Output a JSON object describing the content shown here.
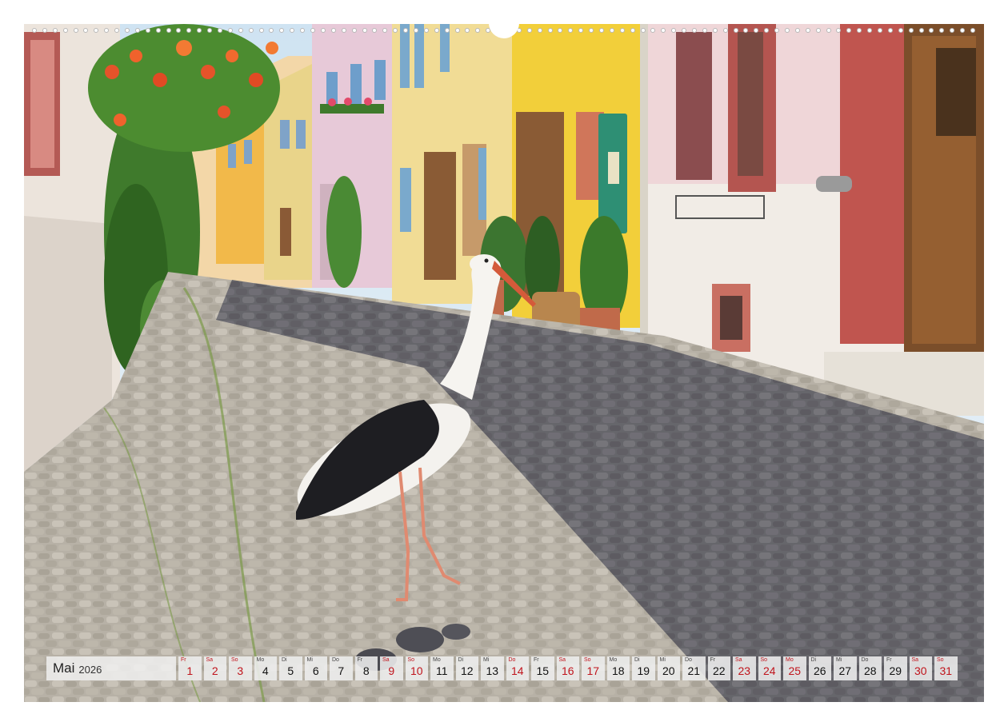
{
  "calendar": {
    "month": "Mai",
    "year": "2026",
    "accent_color": "#c0141c",
    "days": [
      {
        "dow": "Fr",
        "num": "1",
        "red": true
      },
      {
        "dow": "Sa",
        "num": "2",
        "red": true
      },
      {
        "dow": "So",
        "num": "3",
        "red": true
      },
      {
        "dow": "Mo",
        "num": "4",
        "red": false
      },
      {
        "dow": "Di",
        "num": "5",
        "red": false
      },
      {
        "dow": "Mi",
        "num": "6",
        "red": false
      },
      {
        "dow": "Do",
        "num": "7",
        "red": false
      },
      {
        "dow": "Fr",
        "num": "8",
        "red": false
      },
      {
        "dow": "Sa",
        "num": "9",
        "red": true
      },
      {
        "dow": "So",
        "num": "10",
        "red": true
      },
      {
        "dow": "Mo",
        "num": "11",
        "red": false
      },
      {
        "dow": "Di",
        "num": "12",
        "red": false
      },
      {
        "dow": "Mi",
        "num": "13",
        "red": false
      },
      {
        "dow": "Do",
        "num": "14",
        "red": true
      },
      {
        "dow": "Fr",
        "num": "15",
        "red": false
      },
      {
        "dow": "Sa",
        "num": "16",
        "red": true
      },
      {
        "dow": "So",
        "num": "17",
        "red": true
      },
      {
        "dow": "Mo",
        "num": "18",
        "red": false
      },
      {
        "dow": "Di",
        "num": "19",
        "red": false
      },
      {
        "dow": "Mi",
        "num": "20",
        "red": false
      },
      {
        "dow": "Do",
        "num": "21",
        "red": false
      },
      {
        "dow": "Fr",
        "num": "22",
        "red": false
      },
      {
        "dow": "Sa",
        "num": "23",
        "red": true
      },
      {
        "dow": "So",
        "num": "24",
        "red": true
      },
      {
        "dow": "Mo",
        "num": "25",
        "red": true
      },
      {
        "dow": "Di",
        "num": "26",
        "red": false
      },
      {
        "dow": "Mi",
        "num": "27",
        "red": false
      },
      {
        "dow": "Do",
        "num": "28",
        "red": false
      },
      {
        "dow": "Fr",
        "num": "29",
        "red": false
      },
      {
        "dow": "Sa",
        "num": "30",
        "red": true
      },
      {
        "dow": "So",
        "num": "31",
        "red": true
      }
    ]
  }
}
